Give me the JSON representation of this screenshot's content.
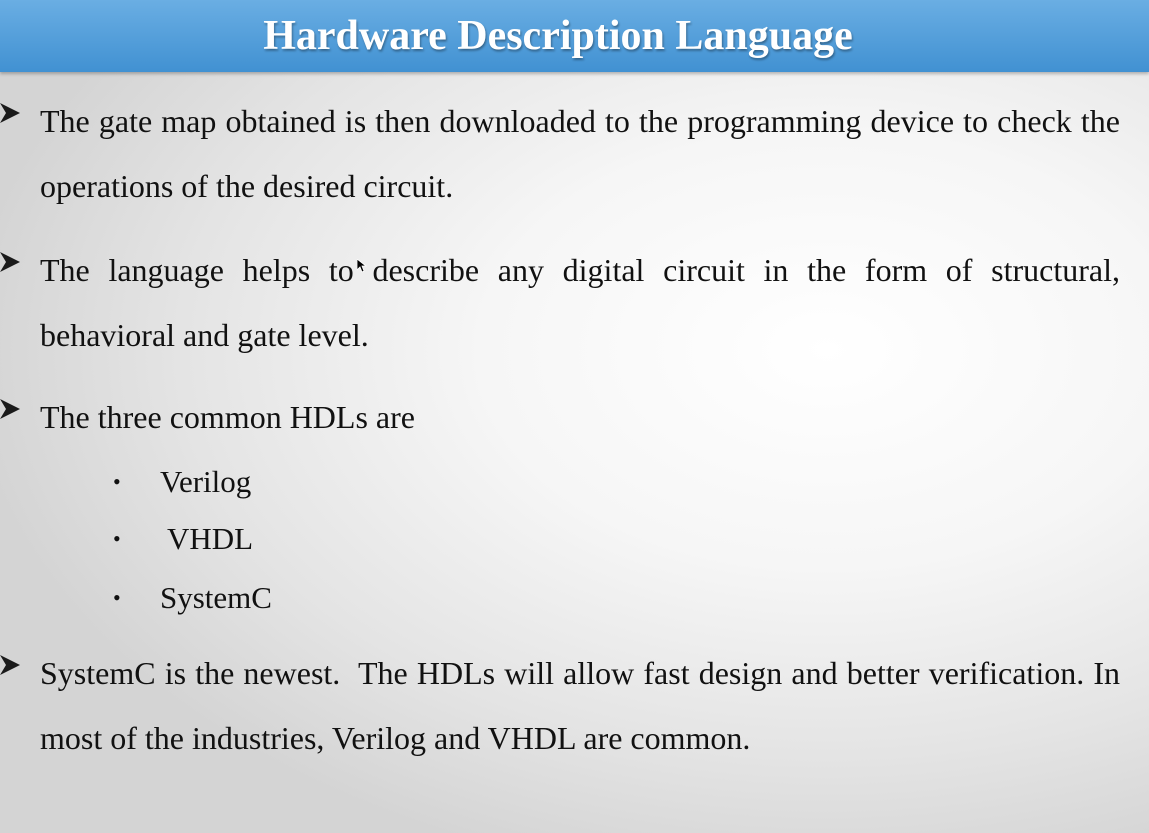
{
  "slide": {
    "title": "Hardware Description Language",
    "bullets": [
      "The gate map obtained is then downloaded to the programming device to check the operations of the desired circuit.",
      "The language helps to describe any digital circuit in the form of structural, behavioral and gate level.",
      "The three common HDLs are",
      "SystemC is the newest.  The HDLs will allow fast design and better verification. In most of the industries, Verilog and VHDL are common."
    ],
    "sub_bullets": [
      "Verilog",
      "VHDL",
      "SystemC"
    ],
    "sub_marker": "•"
  },
  "colors": {
    "title_bar_top": "#6aaee3",
    "title_bar_bottom": "#4191d2",
    "title_text": "#ffffff",
    "body_text": "#111111"
  },
  "icons": {
    "bullet": "arrowhead-bullet-icon",
    "cursor": "mouse-pointer-icon"
  }
}
